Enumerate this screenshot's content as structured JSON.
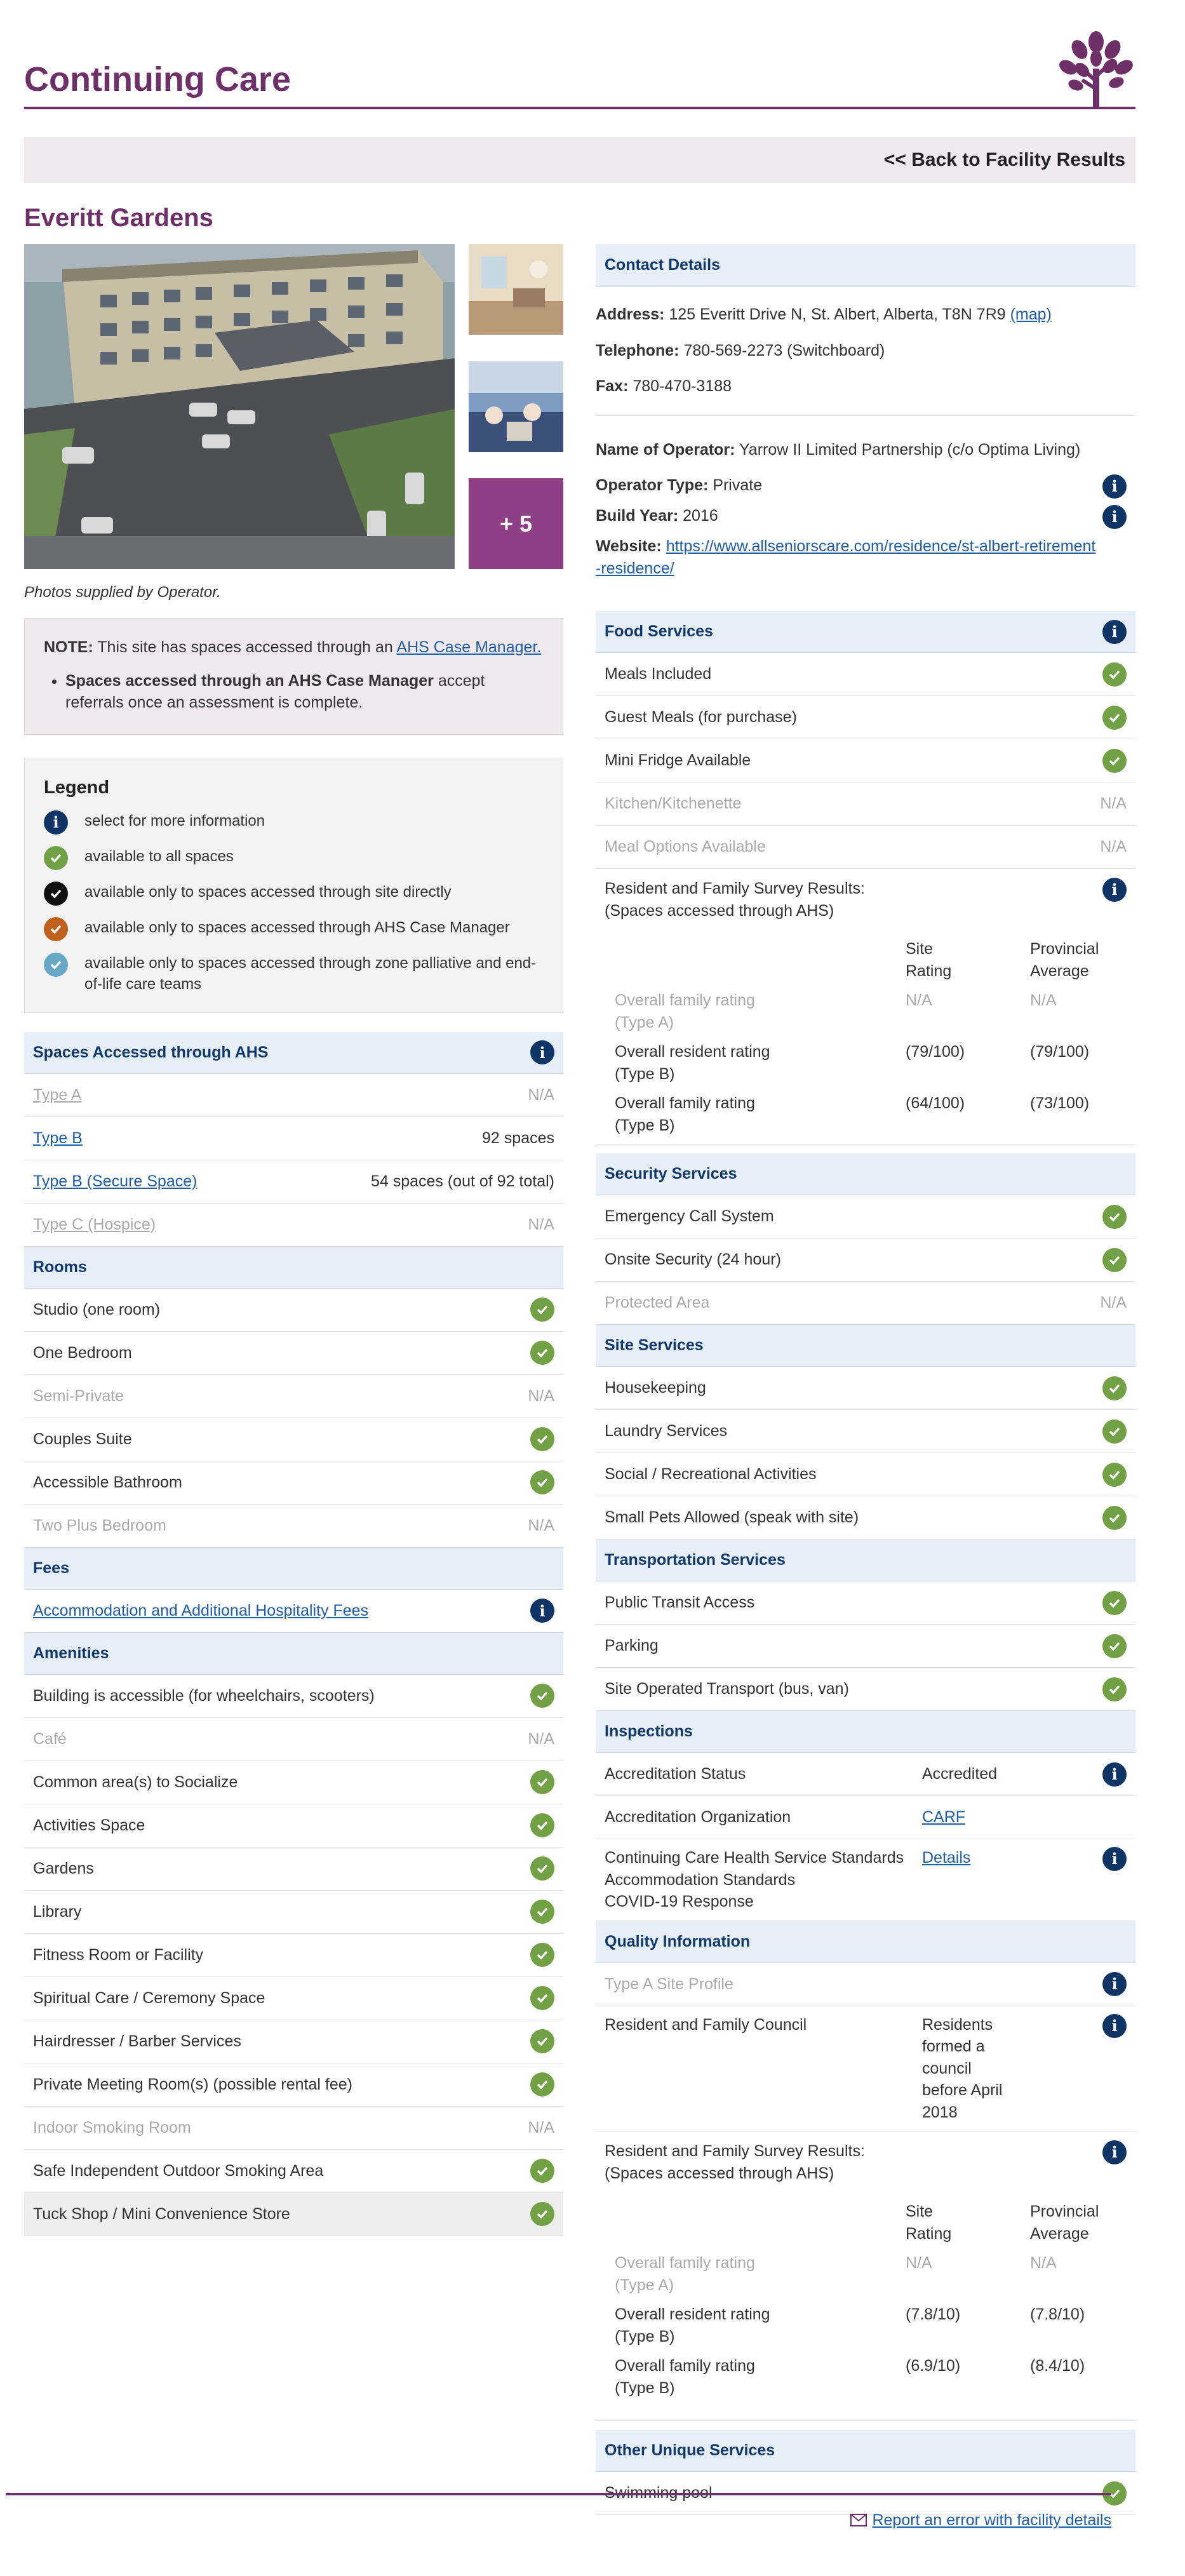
{
  "header": {
    "title": "Continuing Care"
  },
  "back_link": "<< Back to Facility Results",
  "facility_name": "Everitt Gardens",
  "photos": {
    "more_label": "+ 5",
    "credit": "Photos supplied by Operator."
  },
  "note": {
    "prefix": "NOTE:",
    "text": "This site has spaces accessed through an",
    "link": "AHS Case Manager.",
    "bullet_bold": "Spaces accessed through an AHS Case Manager",
    "bullet_rest": "accept referrals once an assessment is complete."
  },
  "legend": {
    "title": "Legend",
    "items": [
      {
        "icon": "info-icon",
        "text": "select for more information"
      },
      {
        "icon": "check-green-icon",
        "text": "available to all spaces"
      },
      {
        "icon": "check-black-icon",
        "text": "available only to spaces accessed through site directly"
      },
      {
        "icon": "check-orange-icon",
        "text": "available only to spaces accessed through AHS Case Manager"
      },
      {
        "icon": "check-blue-icon",
        "text": "available only to spaces accessed through zone palliative and end-of-life care teams"
      }
    ]
  },
  "spaces": {
    "title": "Spaces Accessed through AHS",
    "rows": [
      {
        "label": "Type A",
        "value": "N/A"
      },
      {
        "label": "Type B",
        "value": "92 spaces"
      },
      {
        "label": "Type B (Secure Space)",
        "value": "54 spaces (out of 92 total)"
      },
      {
        "label": "Type C (Hospice)",
        "value": "N/A"
      }
    ]
  },
  "rooms": {
    "title": "Rooms",
    "rows": [
      {
        "label": "Studio (one room)",
        "value": "check"
      },
      {
        "label": "One Bedroom",
        "value": "check"
      },
      {
        "label": "Semi-Private",
        "value": "N/A"
      },
      {
        "label": "Couples Suite",
        "value": "check"
      },
      {
        "label": "Accessible Bathroom",
        "value": "check"
      },
      {
        "label": "Two Plus Bedroom",
        "value": "N/A"
      }
    ]
  },
  "fees": {
    "title": "Fees",
    "link": "Accommodation and Additional Hospitality Fees"
  },
  "amenities": {
    "title": "Amenities",
    "rows": [
      {
        "label": "Building is accessible (for wheelchairs, scooters)",
        "value": "check"
      },
      {
        "label": "Café",
        "value": "N/A"
      },
      {
        "label": "Common area(s) to Socialize",
        "value": "check"
      },
      {
        "label": "Activities Space",
        "value": "check"
      },
      {
        "label": "Gardens",
        "value": "check"
      },
      {
        "label": "Library",
        "value": "check"
      },
      {
        "label": "Fitness Room or Facility",
        "value": "check"
      },
      {
        "label": "Spiritual Care / Ceremony Space",
        "value": "check"
      },
      {
        "label": "Hairdresser / Barber Services",
        "value": "check"
      },
      {
        "label": "Private Meeting Room(s) (possible rental fee)",
        "value": "check"
      },
      {
        "label": "Indoor Smoking Room",
        "value": "N/A"
      },
      {
        "label": "Safe Independent Outdoor Smoking Area",
        "value": "check"
      },
      {
        "label": "Tuck Shop / Mini Convenience Store",
        "value": "check"
      }
    ]
  },
  "contact": {
    "title": "Contact Details",
    "address_label": "Address:",
    "address": "125 Everitt Drive N, St. Albert, Alberta, T8N 7R9",
    "map_link": "(map)",
    "telephone_label": "Telephone:",
    "telephone": "780-569-2273 (Switchboard)",
    "fax_label": "Fax:",
    "fax": "780-470-3188",
    "operator_label": "Name of Operator:",
    "operator": "Yarrow II Limited Partnership (c/o Optima Living)",
    "operator_type_label": "Operator Type:",
    "operator_type": "Private",
    "build_year_label": "Build Year:",
    "build_year": "2016",
    "website_label": "Website:",
    "website": "https://www.allseniorscare.com/residence/st-albert-retirement-residence/"
  },
  "food": {
    "title": "Food Services",
    "rows": [
      {
        "label": "Meals Included",
        "value": "check"
      },
      {
        "label": "Guest Meals (for purchase)",
        "value": "check"
      },
      {
        "label": "Mini Fridge Available",
        "value": "check"
      },
      {
        "label": "Kitchen/Kitchenette",
        "value": "N/A"
      },
      {
        "label": "Meal Options Available",
        "value": "N/A"
      }
    ],
    "survey": {
      "title1": "Resident and Family Survey Results:",
      "title2": "(Spaces accessed through AHS)",
      "col1a": "Site",
      "col1b": "Rating",
      "col2a": "Provincial",
      "col2b": "Average",
      "rows": [
        {
          "l1": "Overall family rating",
          "l2": "(Type A)",
          "site": "N/A",
          "prov": "N/A"
        },
        {
          "l1": "Overall resident rating",
          "l2": "(Type B)",
          "site": "(79/100)",
          "prov": "(79/100)"
        },
        {
          "l1": "Overall family rating",
          "l2": "(Type B)",
          "site": "(64/100)",
          "prov": "(73/100)"
        }
      ]
    }
  },
  "security": {
    "title": "Security Services",
    "rows": [
      {
        "label": "Emergency Call System",
        "value": "check"
      },
      {
        "label": "Onsite Security (24 hour)",
        "value": "check"
      },
      {
        "label": "Protected Area",
        "value": "N/A"
      }
    ]
  },
  "site_services": {
    "title": "Site Services",
    "rows": [
      {
        "label": "Housekeeping",
        "value": "check"
      },
      {
        "label": "Laundry Services",
        "value": "check"
      },
      {
        "label": "Social / Recreational Activities",
        "value": "check"
      },
      {
        "label": "Small Pets Allowed (speak with site)",
        "value": "check"
      }
    ]
  },
  "transport": {
    "title": "Transportation Services",
    "rows": [
      {
        "label": "Public Transit Access",
        "value": "check"
      },
      {
        "label": "Parking",
        "value": "check"
      },
      {
        "label": "Site Operated Transport (bus, van)",
        "value": "check"
      }
    ]
  },
  "inspections": {
    "title": "Inspections",
    "status_label": "Accreditation Status",
    "status": "Accredited",
    "org_label": "Accreditation Organization",
    "org": "CARF",
    "std1": "Continuing Care Health Service Standards",
    "std2": "Accommodation Standards",
    "std3": "COVID-19 Response",
    "details": "Details"
  },
  "quality": {
    "title": "Quality Information",
    "profile": "Type A Site Profile",
    "council_label": "Resident and Family Council",
    "council_value": "Residents formed a council before April 2018",
    "survey": {
      "title1": "Resident and Family Survey Results:",
      "title2": "(Spaces accessed through AHS)",
      "col1a": "Site",
      "col1b": "Rating",
      "col2a": "Provincial",
      "col2b": "Average",
      "rows": [
        {
          "l1": "Overall family rating",
          "l2": "(Type A)",
          "site": "N/A",
          "prov": "N/A"
        },
        {
          "l1": "Overall resident rating",
          "l2": "(Type B)",
          "site": "(7.8/10)",
          "prov": "(7.8/10)"
        },
        {
          "l1": "Overall family rating",
          "l2": "(Type B)",
          "site": "(6.9/10)",
          "prov": "(8.4/10)"
        }
      ]
    }
  },
  "other": {
    "title": "Other Unique Services",
    "rows": [
      {
        "label": "Swimming pool",
        "value": "check"
      }
    ]
  },
  "footer": {
    "report_link": "Report an error with facility details"
  },
  "colors": {
    "brand": "#6e3068",
    "check": "#72a044",
    "info": "#0f3566",
    "header_bg": "#e6eef8"
  }
}
